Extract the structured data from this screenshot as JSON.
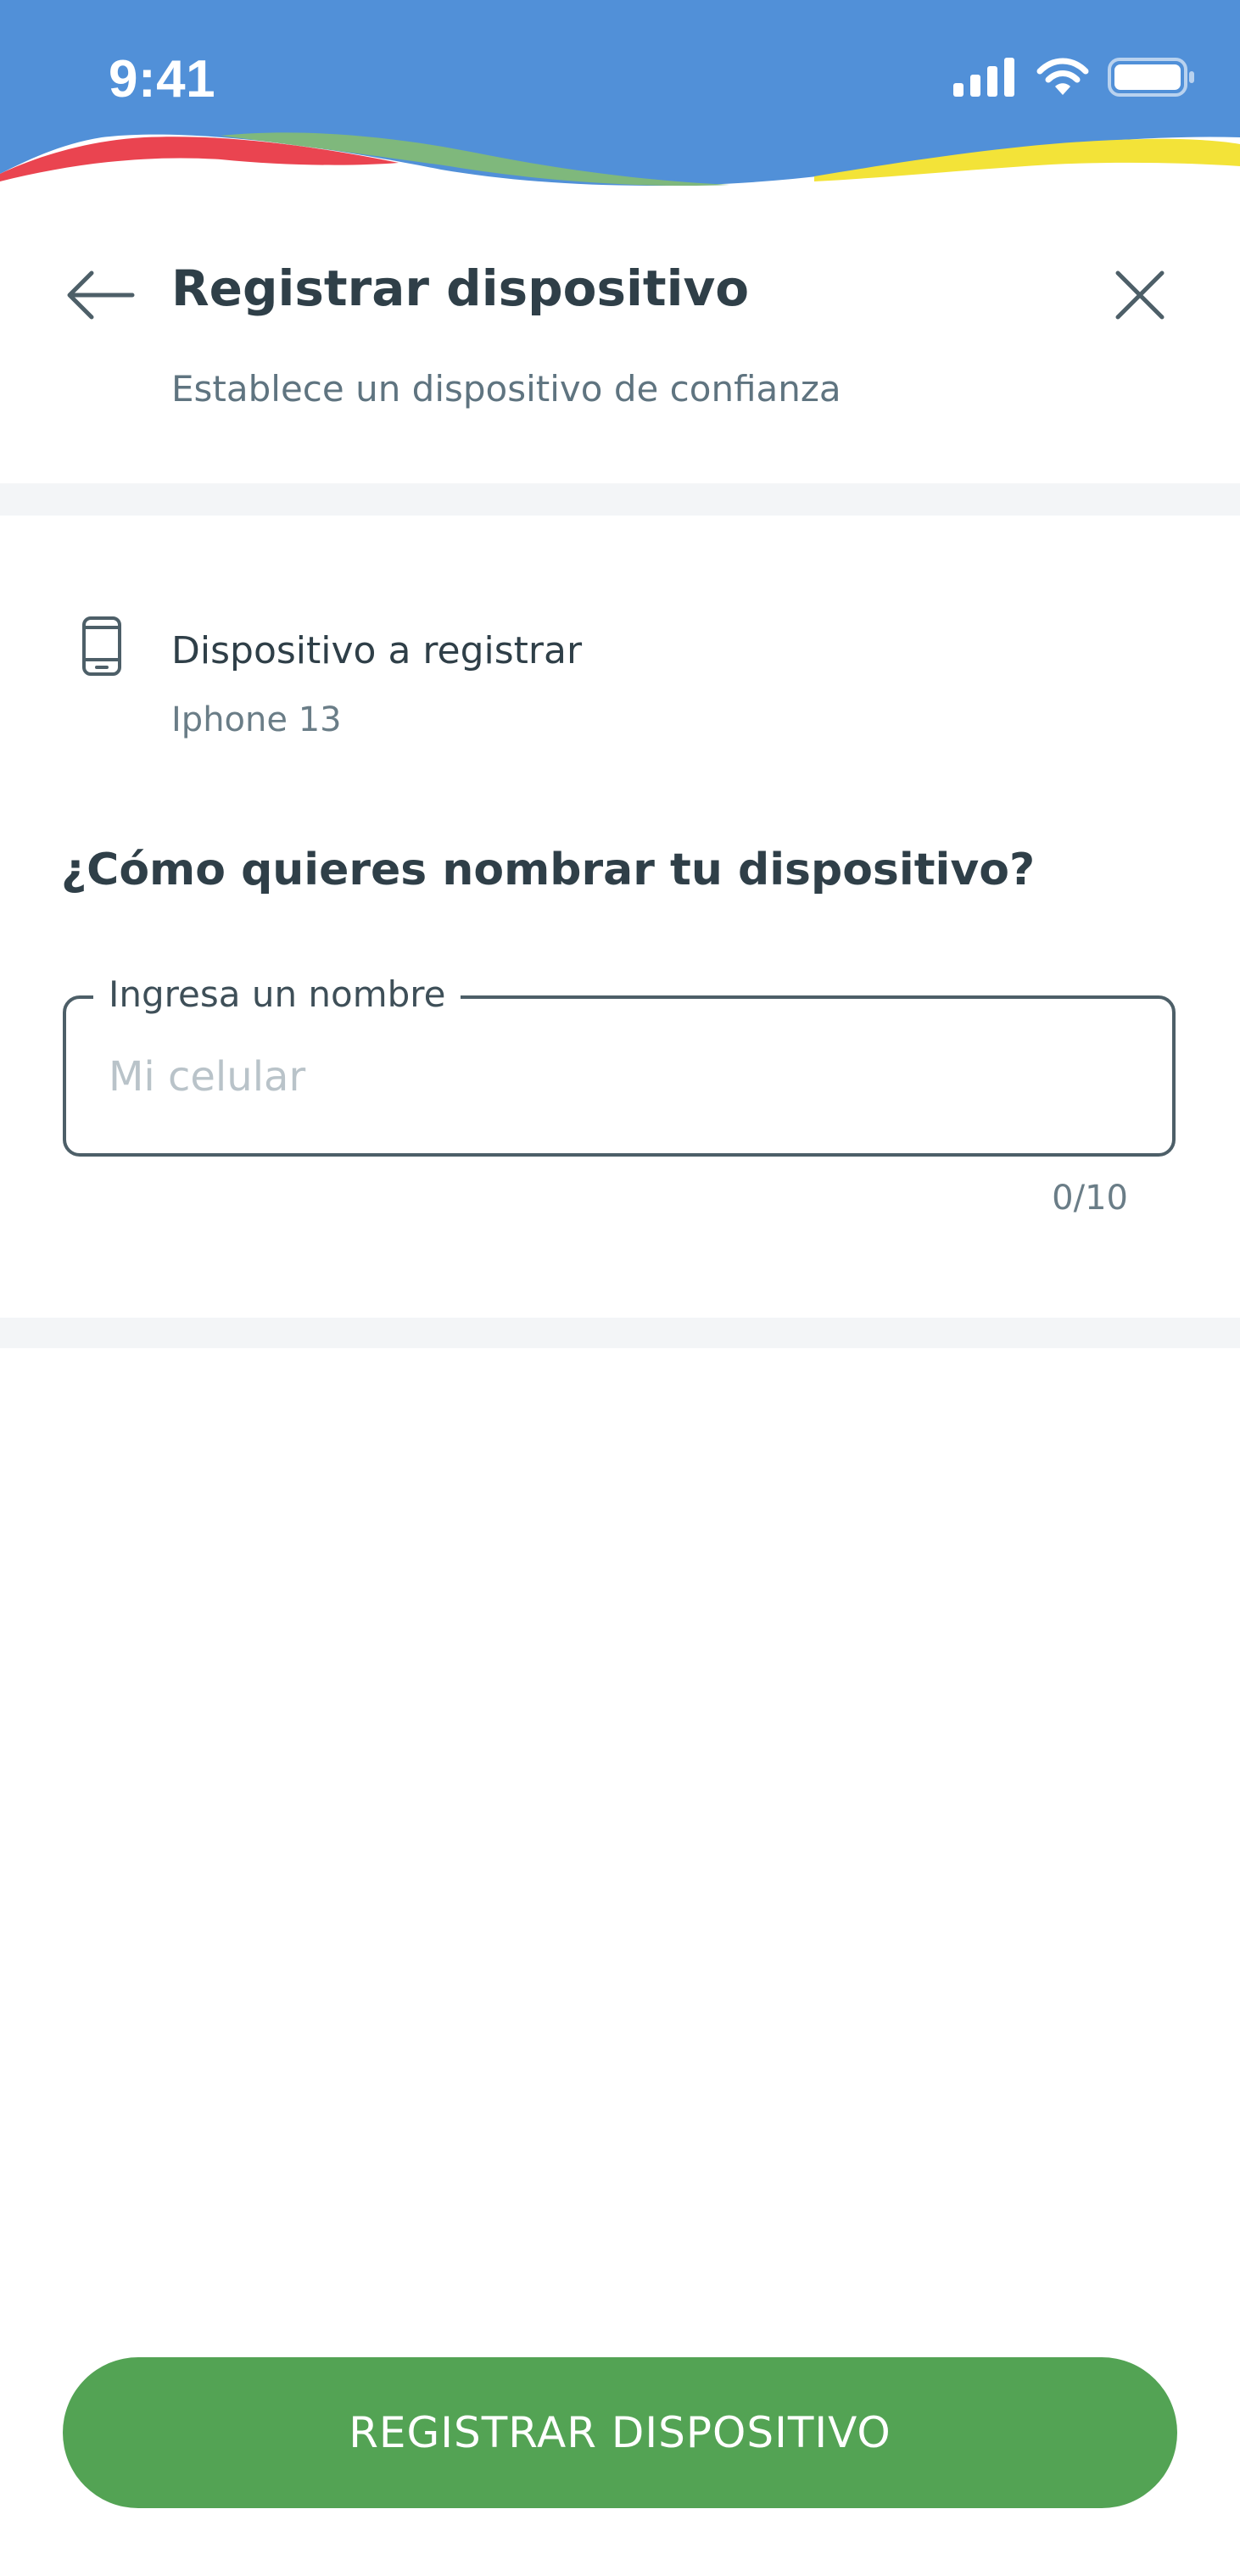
{
  "status_bar": {
    "time": "9:41",
    "icons": [
      "signal-icon",
      "wifi-icon",
      "battery-icon"
    ],
    "background_color": "#5190d8",
    "wave_colors": [
      "#ea4450",
      "#7fb87c",
      "#f3e338"
    ]
  },
  "header": {
    "back_icon": "arrow-left-icon",
    "title": "Registrar dispositivo",
    "subtitle": "Establece un dispositivo de confianza",
    "close_icon": "close-icon"
  },
  "device": {
    "icon": "smartphone-icon",
    "label": "Dispositivo a registrar",
    "value": "Iphone 13"
  },
  "form": {
    "question": "¿Cómo quieres nombrar tu dispositivo?",
    "name_field": {
      "label": "Ingresa un nombre",
      "placeholder": "Mi celular",
      "value": "",
      "counter": "0/10"
    }
  },
  "actions": {
    "submit_label": "REGISTRAR DISPOSITIVO",
    "submit_color": "#53a354"
  }
}
